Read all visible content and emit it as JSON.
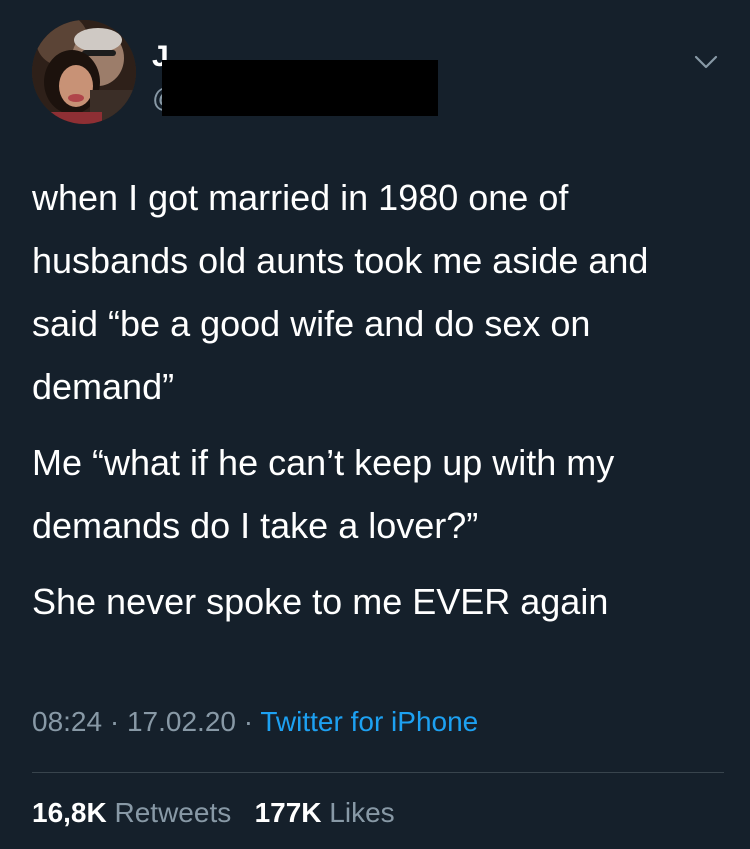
{
  "tweet": {
    "author": {
      "display_name": "J",
      "handle": "@",
      "avatar_icon": "profile-photo-avatar"
    },
    "menu_icon": "chevron-down-icon",
    "paragraphs": [
      "when I got married in 1980 one of husbands old aunts took me aside and said  “be a good wife and do sex on demand”",
      "Me “what if he can’t keep up with my demands do I take a lover?”",
      "She never spoke to me EVER again"
    ],
    "time": "08:24",
    "separator": "·",
    "date": "17.02.20",
    "source": "Twitter for iPhone",
    "retweets": {
      "count": "16,8K",
      "label": "Retweets"
    },
    "likes": {
      "count": "177K",
      "label": "Likes"
    }
  },
  "colors": {
    "background": "#15202b",
    "text": "#ffffff",
    "secondary": "#8899a6",
    "link": "#1da1f2",
    "divider": "#38444d"
  }
}
